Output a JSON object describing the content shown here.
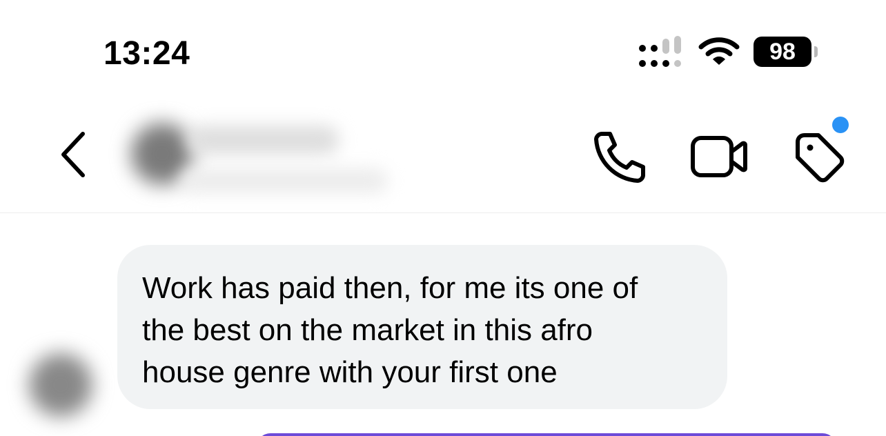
{
  "status_bar": {
    "time": "13:24",
    "battery_level": "98",
    "cell_signal_icon": "cellular-signal-icon",
    "wifi_icon": "wifi-icon"
  },
  "header": {
    "back_icon": "chevron-left-icon",
    "call_icon": "phone-icon",
    "video_icon": "video-camera-icon",
    "tag_icon": "tag-icon",
    "notification_dot_color": "#2a92f5"
  },
  "messages": [
    {
      "direction": "incoming",
      "text": "Work has paid then, for me its one of\nthe best on the market in this afro\nhouse genre with your first one"
    }
  ],
  "colors": {
    "incoming_bubble": "#f1f3f4",
    "outgoing_bubble": "#6d4bd8",
    "text": "#000000"
  }
}
